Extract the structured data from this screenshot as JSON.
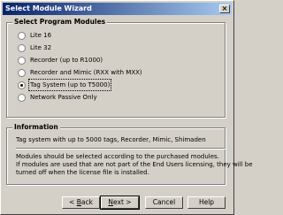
{
  "window": {
    "title": "Select Module Wizard",
    "close_glyph": "×"
  },
  "modules": {
    "heading": "Select Program Modules",
    "options": [
      {
        "label": "Lite 16",
        "selected": false
      },
      {
        "label": "Lite 32",
        "selected": false
      },
      {
        "label": "Recorder (up to R1000)",
        "selected": false
      },
      {
        "label": "Recorder and Mimic (RXX with MXX)",
        "selected": false
      },
      {
        "label": "Tag System (up to T5000)",
        "selected": true
      },
      {
        "label": "Network Passive Only",
        "selected": false
      }
    ]
  },
  "information": {
    "heading": "Information",
    "description": "Tag system with up to 5000 tags, Recorder, Mimic, Shimaden",
    "note_lines": [
      "Modules should be selected according to the purchased modules.",
      "If modules are used that are not part of the End Users licensing, they will be",
      "turned off when the license file is installed."
    ]
  },
  "buttons": {
    "back": {
      "prefix": "< ",
      "access": "B",
      "rest": "ack"
    },
    "next": {
      "access": "N",
      "rest": "ext >"
    },
    "cancel": "Cancel",
    "help": "Help"
  }
}
